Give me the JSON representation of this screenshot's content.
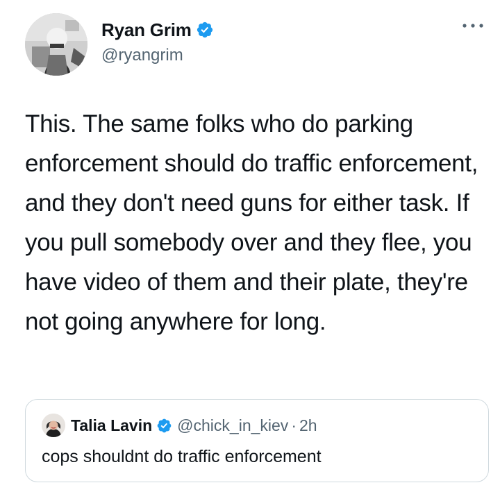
{
  "author": {
    "name": "Ryan Grim",
    "handle": "@ryangrim",
    "verified": true,
    "avatar_icon": "vintage-photo-avatar"
  },
  "menu": {
    "icon": "more-horizontal-icon"
  },
  "tweet": {
    "text": "This. The same folks who do parking enforcement should do traffic enforcement, and they don't need guns for either task. If you pull somebody over and they flee, you have video of them and their plate, they're not going anywhere for long."
  },
  "quoted_tweet": {
    "name": "Talia Lavin",
    "handle": "@chick_in_kiev",
    "separator": "·",
    "time": "2h",
    "text": "cops shouldnt do traffic enforcement",
    "verified": true,
    "avatar_icon": "profile-photo-avatar"
  },
  "colors": {
    "verified_blue": "#1d9bf0",
    "secondary_text": "#536471",
    "primary_text": "#0f1419",
    "border": "#cfd9de"
  }
}
